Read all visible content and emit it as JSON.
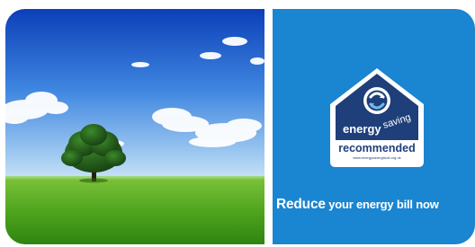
{
  "banner": {
    "photo": {
      "description_icon": "tree-in-field-photo"
    },
    "logo": {
      "word_energy": "energy",
      "word_saving": "saving",
      "word_recommended": "recommended",
      "url": "www.energysavingtrust.org.uk",
      "icon": "energy-saving-recommended-logo"
    },
    "tagline": {
      "first": "Reduce",
      "rest": " your energy bill now"
    }
  },
  "colors": {
    "panel_blue": "#1a85d0",
    "logo_navy": "#1f3f7a",
    "white": "#ffffff"
  }
}
